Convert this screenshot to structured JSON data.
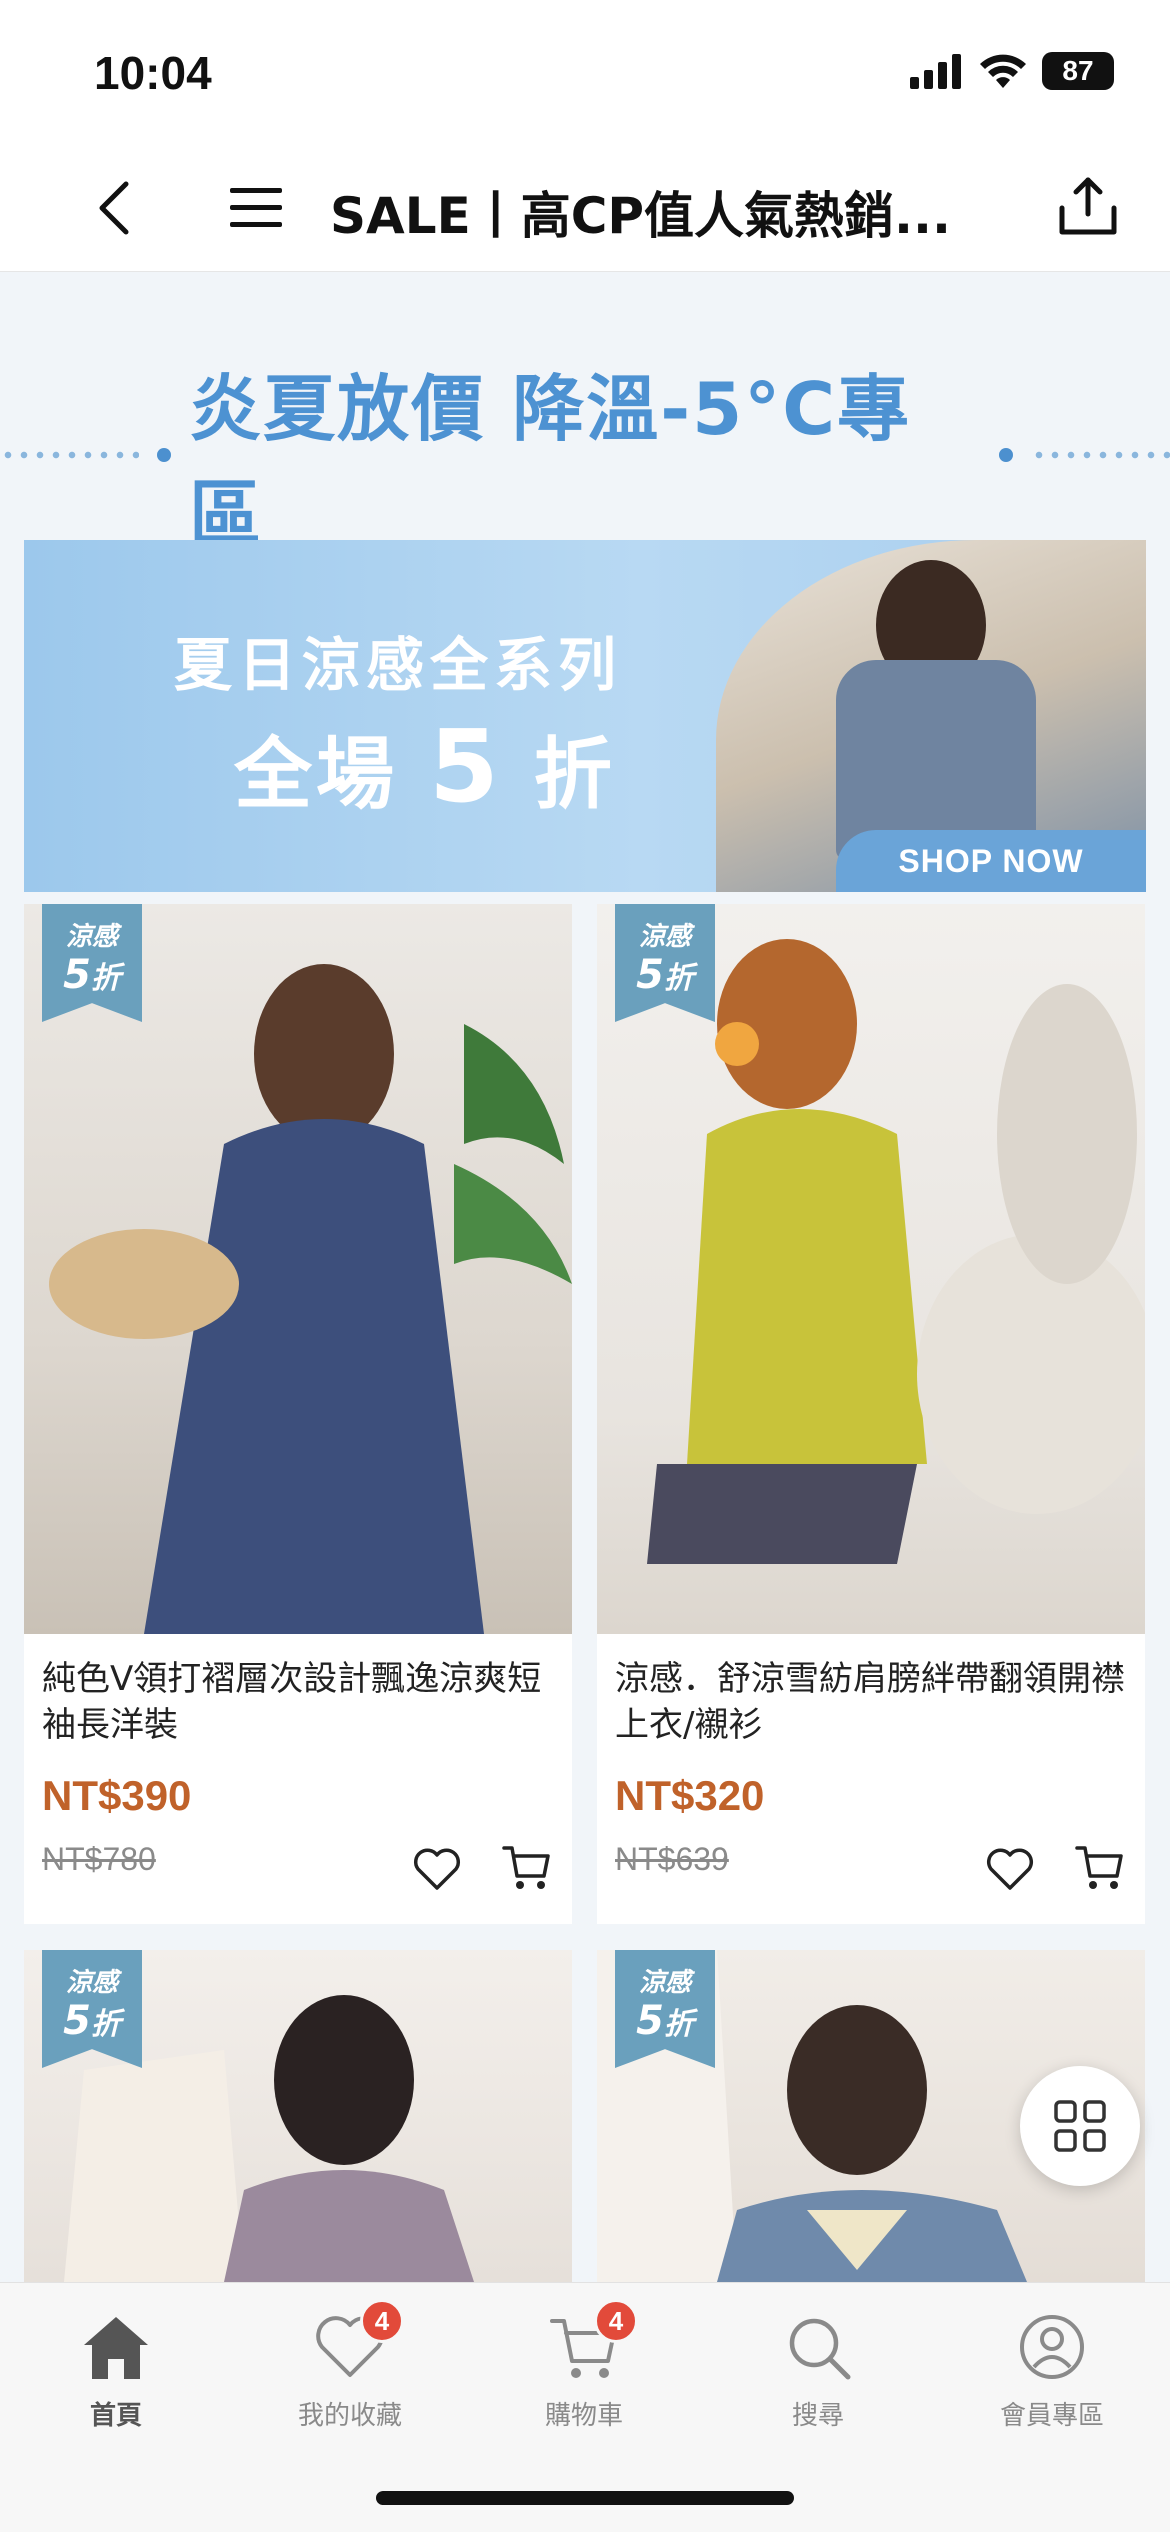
{
  "status_bar": {
    "time": "10:04",
    "battery": "87"
  },
  "header": {
    "title": "SALE丨高CP值人氣熱銷...",
    "back_icon": "chevron-left-icon",
    "menu_icon": "hamburger-menu-icon",
    "share_icon": "share-icon"
  },
  "section": {
    "heading": "炎夏放價 降溫-5°C專區"
  },
  "promo": {
    "line1": "夏日涼感全系列",
    "line2_prefix": "全場",
    "line2_number": "5",
    "line2_suffix": "折",
    "cta": "SHOP NOW"
  },
  "badge": {
    "top": "涼感",
    "bottom_number": "5",
    "bottom_suffix": "折"
  },
  "products": [
    {
      "name": "純色V領打褶層次設計飄逸涼爽短袖長洋裝",
      "price": "NT$390",
      "original_price": "NT$780",
      "image_colors": [
        "#e9e6e2",
        "#3d4f7c"
      ]
    },
    {
      "name": "涼感．舒涼雪紡肩膀絆帶翻領開襟上衣/襯衫",
      "price": "NT$320",
      "original_price": "NT$639",
      "image_colors": [
        "#f1efec",
        "#c8c33a"
      ]
    },
    {
      "name": "",
      "price": "",
      "original_price": "",
      "image_colors": [
        "#ece8e4",
        "#9b8a9d"
      ]
    },
    {
      "name": "",
      "price": "",
      "original_price": "",
      "image_colors": [
        "#ebe6e0",
        "#6f8aab"
      ]
    }
  ],
  "tabs": [
    {
      "label": "首頁",
      "icon": "home-icon",
      "active": true
    },
    {
      "label": "我的收藏",
      "icon": "heart-icon",
      "badge": "4"
    },
    {
      "label": "購物車",
      "icon": "cart-icon",
      "badge": "4"
    },
    {
      "label": "搜尋",
      "icon": "search-icon"
    },
    {
      "label": "會員專區",
      "icon": "user-icon"
    }
  ],
  "colors": {
    "accent_blue": "#4d92d2",
    "price_orange": "#c0622a",
    "badge_blue": "#6aa0bd",
    "notification_red": "#e24a3a"
  }
}
